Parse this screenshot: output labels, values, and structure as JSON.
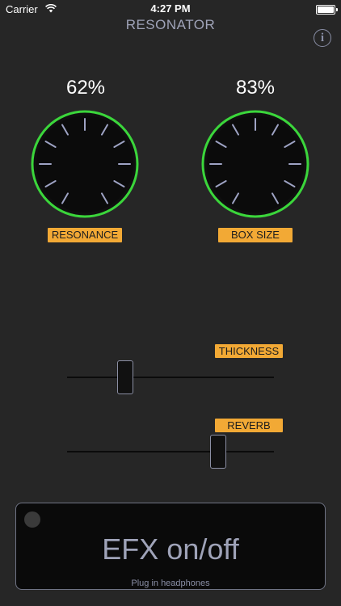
{
  "status_bar": {
    "carrier": "Carrier",
    "time": "4:27 PM"
  },
  "app": {
    "title": "RESONATOR"
  },
  "knobs": [
    {
      "label": "RESONANCE",
      "value": "62%",
      "fraction": 0.62
    },
    {
      "label": "BOX SIZE",
      "value": "83%",
      "fraction": 0.83
    }
  ],
  "sliders": [
    {
      "label": "THICKNESS",
      "fraction": 0.28
    },
    {
      "label": "REVERB",
      "fraction": 0.73
    }
  ],
  "efx": {
    "label": "EFX on/off",
    "hint": "Plug in headphones"
  },
  "colors": {
    "background": "#262626",
    "accent": "#f2a935",
    "knob_ring": "#3bd63b",
    "text_muted": "#9fa3b8"
  }
}
